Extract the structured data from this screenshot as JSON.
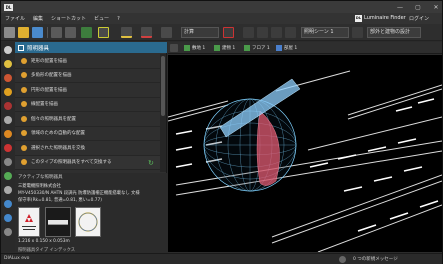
{
  "title_bar": {
    "logo_text": "DL",
    "controls": [
      "—",
      "▢",
      "✕"
    ]
  },
  "menu": {
    "items": [
      "ファイル",
      "編集",
      "ショートカット",
      "ビュー",
      "?"
    ],
    "brand_box": "DL",
    "brand": "Luminaire Finder",
    "login": "ログイン"
  },
  "toolbar": {
    "calc_label": "計算",
    "view_dropdown": "照明シーン 1",
    "design_dropdown": "部外と建物の設計"
  },
  "left_panel": {
    "header": "照明器具",
    "items": [
      "矩形の配置を描画",
      "多角形の配置を描画",
      "円形の配置を描画",
      "線配置を描画",
      "個々の照明器具を配置",
      "領域のための自動的な配置",
      "選択された照明器具を交換",
      "このタイプの照明器具をすべて交換する"
    ],
    "active": {
      "title": "アクティブな照明器具",
      "manufacturer": "三菱電機照明株式会社",
      "product_line1": "MY-V450330/N AHTN 段調光 防爆防護柵正機能搭載なし 文様",
      "product_line2": "保守率(Rk=0.81, 普通=0.81, 悪い=0.77)",
      "size": "1.216 x 0.150 x 0.053m",
      "type": "照明器具タイプ インデックス"
    }
  },
  "viewport_tabs": [
    "敷地 1",
    "建物 1",
    "フロア 1",
    "部屋 1"
  ],
  "status": {
    "left": "DIALux evo",
    "right": "0 つの新規メッセージ"
  },
  "colors": {
    "accent": "#2a6a8f",
    "sphere": "#7fd2ff",
    "beam": "#8fd0ff",
    "red_region": "#e25a70",
    "wire": "#dddddd"
  }
}
